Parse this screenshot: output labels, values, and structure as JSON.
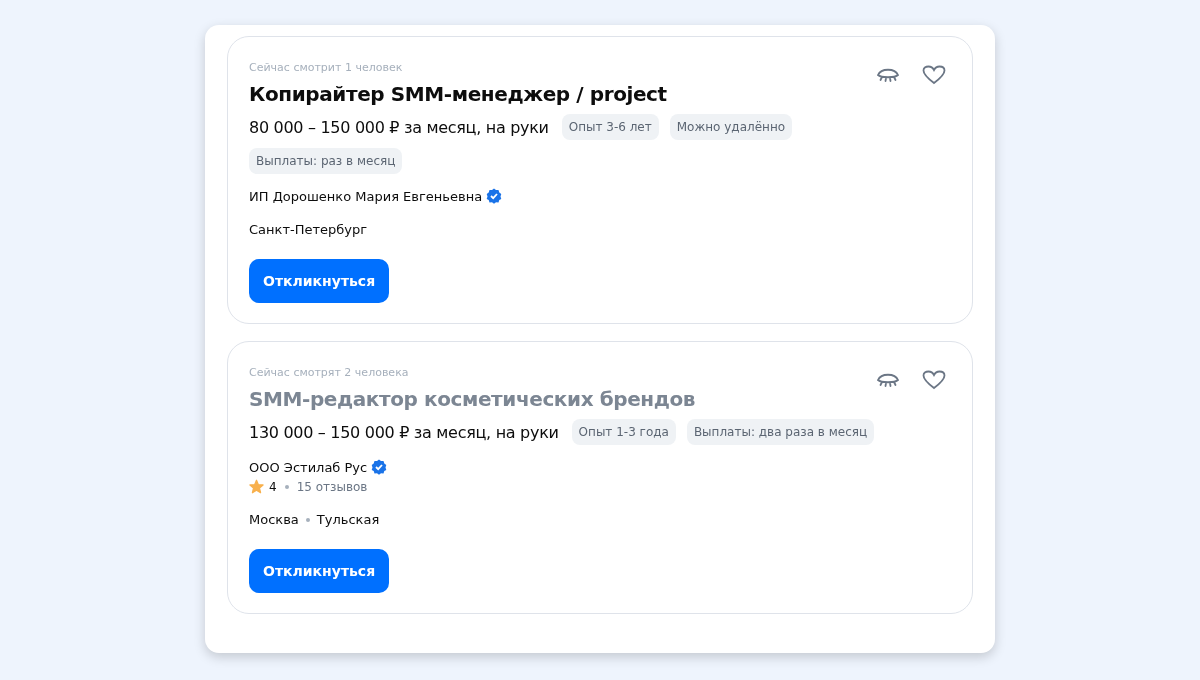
{
  "vacancies": [
    {
      "viewers": "Сейчас смотрит 1 человек",
      "title": "Копирайтер SMM-менеджер / project",
      "visited": false,
      "salary": "80 000 – 150 000 ₽ за месяц, на руки",
      "tags": [
        "Опыт 3-6 лет",
        "Можно удалённо",
        "Выплаты: раз в месяц"
      ],
      "company": "ИП Дорошенко Мария Евгеньевна",
      "verified": true,
      "location": "Санкт-Петербург",
      "button": "Откликнуться"
    },
    {
      "viewers": "Сейчас смотрят 2 человека",
      "title": "SMM-редактор косметических брендов",
      "visited": true,
      "salary": "130 000 – 150 000 ₽ за месяц, на руки",
      "tags": [
        "Опыт 1-3 года",
        "Выплаты: два раза в месяц"
      ],
      "company": "ООО Эстилаб Рус",
      "verified": true,
      "rating": "4",
      "reviews": "15 отзывов",
      "location": "Москва",
      "metro": "Тульская",
      "button": "Откликнуться"
    }
  ]
}
